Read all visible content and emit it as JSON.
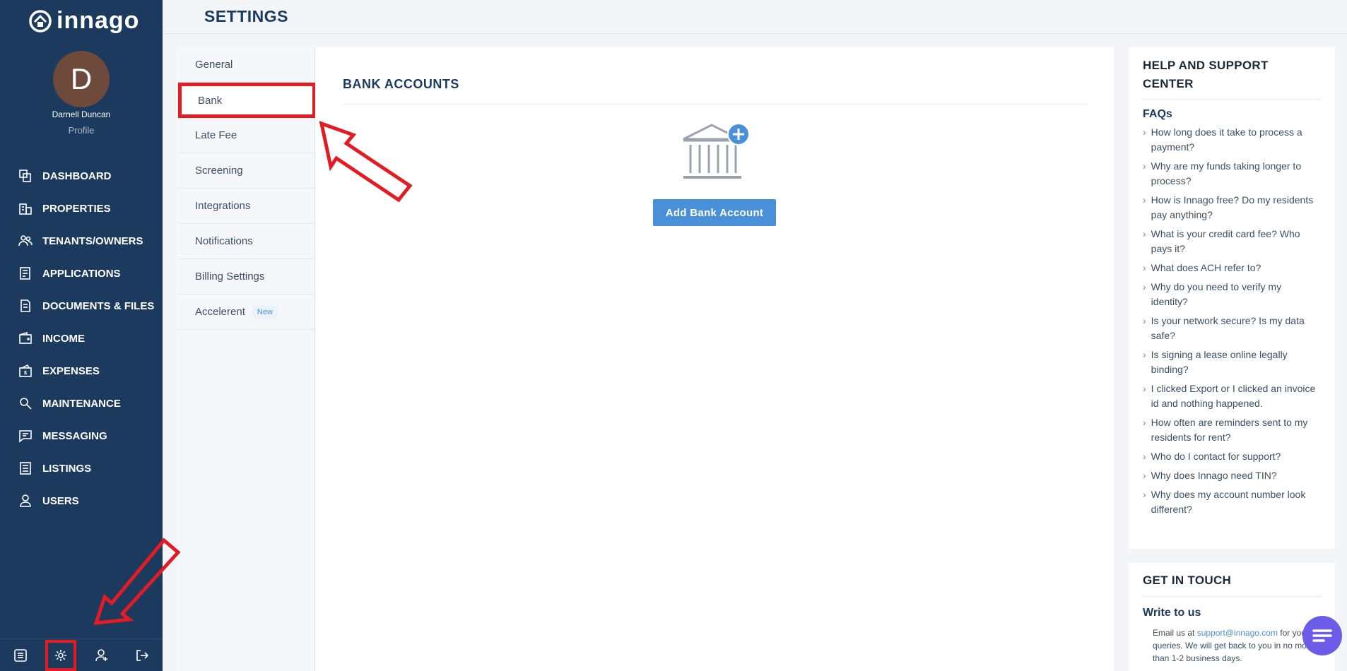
{
  "app": {
    "logo_text": "innago"
  },
  "user": {
    "initial": "D",
    "name": "Darnell Duncan",
    "profile_label": "Profile"
  },
  "sidebar": {
    "items": [
      {
        "label": "DASHBOARD",
        "icon": "dashboard-icon"
      },
      {
        "label": "PROPERTIES",
        "icon": "building-icon"
      },
      {
        "label": "TENANTS/OWNERS",
        "icon": "people-icon"
      },
      {
        "label": "APPLICATIONS",
        "icon": "application-icon"
      },
      {
        "label": "DOCUMENTS & FILES",
        "icon": "document-icon"
      },
      {
        "label": "INCOME",
        "icon": "wallet-icon"
      },
      {
        "label": "EXPENSES",
        "icon": "expense-icon"
      },
      {
        "label": "MAINTENANCE",
        "icon": "wrench-icon"
      },
      {
        "label": "MESSAGING",
        "icon": "message-icon"
      },
      {
        "label": "LISTINGS",
        "icon": "listing-icon"
      },
      {
        "label": "USERS",
        "icon": "user-icon"
      }
    ],
    "bottom_icons": [
      "list-icon",
      "settings-gear-icon",
      "user-plus-icon",
      "logout-icon"
    ]
  },
  "header": {
    "title": "SETTINGS"
  },
  "settings_menu": {
    "items": [
      "General",
      "Bank",
      "Late Fee",
      "Screening",
      "Integrations",
      "Notifications",
      "Billing Settings",
      "Accelerent"
    ],
    "active": "Bank",
    "accelerent_badge": "New"
  },
  "main": {
    "title": "BANK ACCOUNTS",
    "add_button": "Add Bank Account",
    "illustration": "bank-building-plus-icon"
  },
  "help": {
    "title": "HELP AND SUPPORT CENTER",
    "faq_title": "FAQs",
    "faqs": [
      "How long does it take to process a payment?",
      "Why are my funds taking longer to process?",
      "How is Innago free? Do my residents pay anything?",
      "What is your credit card fee? Who pays it?",
      "What does ACH refer to?",
      "Why do you need to verify my identity?",
      "Is your network secure? Is my data safe?",
      "Is signing a lease online legally binding?",
      "I clicked Export or I clicked an invoice id and nothing happened.",
      "How often are reminders sent to my residents for rent?",
      "Who do I contact for support?",
      "Why does Innago need TIN?",
      "Why does my account number look different?"
    ]
  },
  "contact": {
    "title": "GET IN TOUCH",
    "subtitle": "Write to us",
    "text_before": "Email us at ",
    "email": "support@innago.com",
    "text_after": " for your queries. We will get back to you in no more than 1-2 business days."
  },
  "colors": {
    "sidebar": "#1c3a5e",
    "accent": "#4a90d9",
    "annotation": "#e31b23",
    "chat": "#6c5ce7"
  }
}
